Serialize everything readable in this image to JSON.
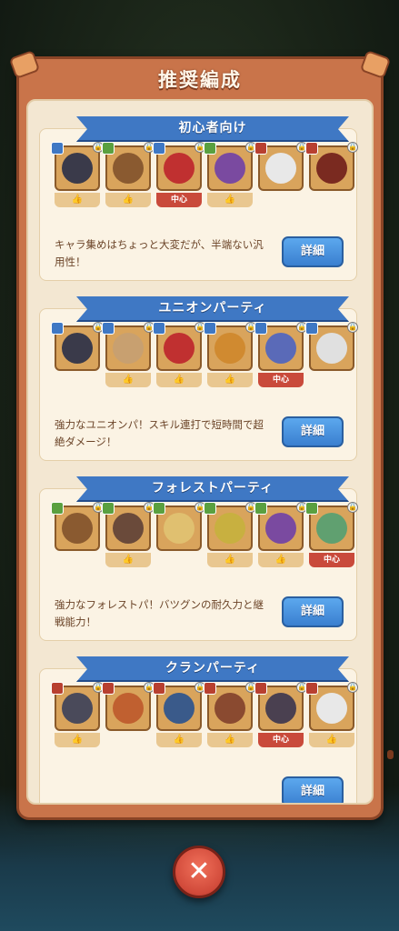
{
  "modal": {
    "title": "推奨編成",
    "close_icon": "close-icon"
  },
  "colors": {
    "ribbon": "#3f78c4",
    "button": "#3a7fd0",
    "center_tag": "#c94a3b"
  },
  "sections": [
    {
      "name": "初心者向け",
      "description": "キャラ集めはちょっと大変だが、半端ない汎用性！",
      "detail_label": "詳細",
      "characters": [
        {
          "badge": "union",
          "badge_color": "#3f78c4",
          "face": "#3a3a4a",
          "tag": "👍"
        },
        {
          "badge": "forest",
          "badge_color": "#5aa040",
          "face": "#8a5a30",
          "tag": "👍"
        },
        {
          "badge": "union",
          "badge_color": "#3f78c4",
          "face": "#c03030",
          "tag": "中心"
        },
        {
          "badge": "forest",
          "badge_color": "#5aa040",
          "face": "#7a4aa0",
          "tag": "👍"
        },
        {
          "badge": "clan",
          "badge_color": "#b84030",
          "face": "#e8e8e8",
          "tag": ""
        },
        {
          "badge": "clan",
          "badge_color": "#b84030",
          "face": "#7a2a20",
          "tag": ""
        }
      ]
    },
    {
      "name": "ユニオンパーティ",
      "description": "強力なユニオンパ！スキル連打で短時間で超絶ダメージ！",
      "detail_label": "詳細",
      "characters": [
        {
          "badge": "union",
          "badge_color": "#3f78c4",
          "face": "#3a3a4a",
          "tag": ""
        },
        {
          "badge": "union",
          "badge_color": "#3f78c4",
          "face": "#c8a070",
          "tag": "👍"
        },
        {
          "badge": "union",
          "badge_color": "#3f78c4",
          "face": "#c03030",
          "tag": "👍"
        },
        {
          "badge": "union",
          "badge_color": "#3f78c4",
          "face": "#d08a30",
          "tag": "👍"
        },
        {
          "badge": "union",
          "badge_color": "#3f78c4",
          "face": "#5a6ab8",
          "tag": "中心"
        },
        {
          "badge": "union",
          "badge_color": "#3f78c4",
          "face": "#e0e0e0",
          "tag": ""
        }
      ]
    },
    {
      "name": "フォレストパーティ",
      "description": "強力なフォレストパ！バツグンの耐久力と継戦能力！",
      "detail_label": "詳細",
      "characters": [
        {
          "badge": "forest",
          "badge_color": "#5aa040",
          "face": "#8a5a30",
          "tag": ""
        },
        {
          "badge": "forest",
          "badge_color": "#5aa040",
          "face": "#6a4a3a",
          "tag": "👍"
        },
        {
          "badge": "forest",
          "badge_color": "#5aa040",
          "face": "#e0c070",
          "tag": ""
        },
        {
          "badge": "forest",
          "badge_color": "#5aa040",
          "face": "#c8b040",
          "tag": "👍"
        },
        {
          "badge": "forest",
          "badge_color": "#5aa040",
          "face": "#7a4aa0",
          "tag": "👍"
        },
        {
          "badge": "forest",
          "badge_color": "#5aa040",
          "face": "#60a070",
          "tag": "中心"
        }
      ]
    },
    {
      "name": "クランパーティ",
      "description": "",
      "detail_label": "詳細",
      "characters": [
        {
          "badge": "clan",
          "badge_color": "#b84030",
          "face": "#4a4a5a",
          "tag": "👍"
        },
        {
          "badge": "clan",
          "badge_color": "#b84030",
          "face": "#c06030",
          "tag": ""
        },
        {
          "badge": "clan",
          "badge_color": "#b84030",
          "face": "#3a5a8a",
          "tag": "👍"
        },
        {
          "badge": "clan",
          "badge_color": "#b84030",
          "face": "#8a4a30",
          "tag": "👍"
        },
        {
          "badge": "clan",
          "badge_color": "#b84030",
          "face": "#4a4050",
          "tag": "中心"
        },
        {
          "badge": "clan",
          "badge_color": "#b84030",
          "face": "#e8e8e8",
          "tag": "👍"
        }
      ]
    }
  ]
}
